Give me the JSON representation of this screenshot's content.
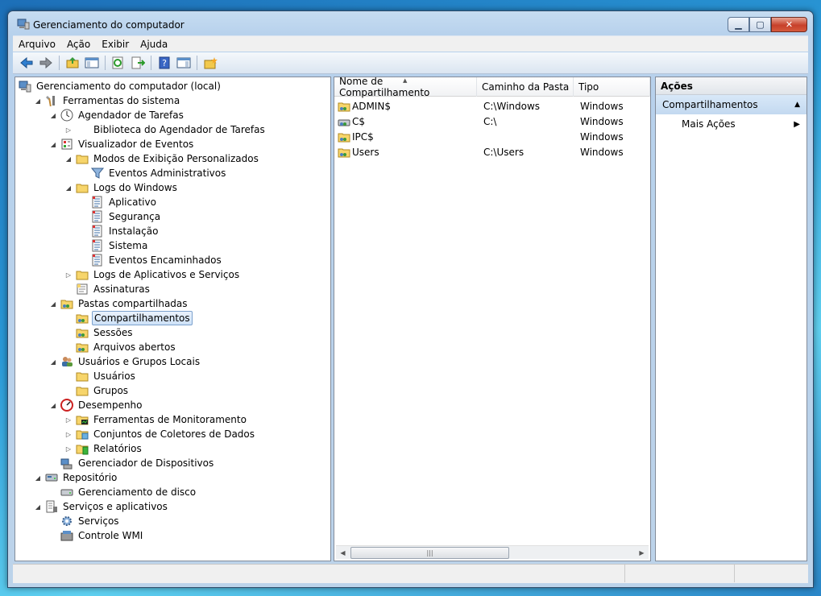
{
  "window": {
    "title": "Gerenciamento do computador",
    "controls": {
      "minimize": "▁",
      "maximize": "▢",
      "close": "✕"
    }
  },
  "menu": [
    "Arquivo",
    "Ação",
    "Exibir",
    "Ajuda"
  ],
  "toolbar": [
    "back-icon",
    "forward-icon",
    "up-folder-icon",
    "show-hide-tree-icon",
    "refresh-icon",
    "export-list-icon",
    "help-icon",
    "show-hide-action-pane-icon",
    "new-share-icon"
  ],
  "tree": [
    {
      "label": "Gerenciamento do computador (local)",
      "level": 0,
      "expander": "",
      "icon": "computer-management-icon"
    },
    {
      "label": "Ferramentas do sistema",
      "level": 1,
      "expander": "open",
      "icon": "system-tools-icon"
    },
    {
      "label": "Agendador de Tarefas",
      "level": 2,
      "expander": "open",
      "icon": "clock-icon"
    },
    {
      "label": "Biblioteca do Agendador de Tarefas",
      "level": 3,
      "expander": "closed",
      "icon": ""
    },
    {
      "label": "Visualizador de Eventos",
      "level": 2,
      "expander": "open",
      "icon": "event-viewer-icon"
    },
    {
      "label": "Modos de Exibição Personalizados",
      "level": 3,
      "expander": "open",
      "icon": "folder-icon"
    },
    {
      "label": "Eventos Administrativos",
      "level": 4,
      "expander": "",
      "icon": "filter-icon"
    },
    {
      "label": "Logs do Windows",
      "level": 3,
      "expander": "open",
      "icon": "folder-icon"
    },
    {
      "label": "Aplicativo",
      "level": 4,
      "expander": "",
      "icon": "log-icon"
    },
    {
      "label": "Segurança",
      "level": 4,
      "expander": "",
      "icon": "log-icon"
    },
    {
      "label": "Instalação",
      "level": 4,
      "expander": "",
      "icon": "log-icon"
    },
    {
      "label": "Sistema",
      "level": 4,
      "expander": "",
      "icon": "log-icon"
    },
    {
      "label": "Eventos Encaminhados",
      "level": 4,
      "expander": "",
      "icon": "log-icon"
    },
    {
      "label": "Logs de Aplicativos e Serviços",
      "level": 3,
      "expander": "closed",
      "icon": "folder-icon"
    },
    {
      "label": "Assinaturas",
      "level": 3,
      "expander": "",
      "icon": "subscriptions-icon"
    },
    {
      "label": "Pastas compartilhadas",
      "level": 2,
      "expander": "open",
      "icon": "shared-folder-icon"
    },
    {
      "label": "Compartilhamentos",
      "level": 3,
      "expander": "",
      "icon": "shared-folder-icon",
      "selected": true
    },
    {
      "label": "Sessões",
      "level": 3,
      "expander": "",
      "icon": "shared-folder-icon"
    },
    {
      "label": "Arquivos abertos",
      "level": 3,
      "expander": "",
      "icon": "shared-folder-icon"
    },
    {
      "label": "Usuários e Grupos Locais",
      "level": 2,
      "expander": "open",
      "icon": "users-icon"
    },
    {
      "label": "Usuários",
      "level": 3,
      "expander": "",
      "icon": "folder-icon"
    },
    {
      "label": "Grupos",
      "level": 3,
      "expander": "",
      "icon": "folder-icon"
    },
    {
      "label": "Desempenho",
      "level": 2,
      "expander": "open",
      "icon": "performance-icon"
    },
    {
      "label": "Ferramentas de Monitoramento",
      "level": 3,
      "expander": "closed",
      "icon": "monitor-folder-icon"
    },
    {
      "label": "Conjuntos de Coletores de Dados",
      "level": 3,
      "expander": "closed",
      "icon": "collector-folder-icon"
    },
    {
      "label": "Relatórios",
      "level": 3,
      "expander": "closed",
      "icon": "reports-folder-icon"
    },
    {
      "label": "Gerenciador de Dispositivos",
      "level": 2,
      "expander": "",
      "icon": "device-manager-icon"
    },
    {
      "label": "Repositório",
      "level": 1,
      "expander": "open",
      "icon": "storage-icon"
    },
    {
      "label": "Gerenciamento de disco",
      "level": 2,
      "expander": "",
      "icon": "disk-icon"
    },
    {
      "label": "Serviços e aplicativos",
      "level": 1,
      "expander": "open",
      "icon": "services-apps-icon"
    },
    {
      "label": "Serviços",
      "level": 2,
      "expander": "",
      "icon": "gear-icon"
    },
    {
      "label": "Controle WMI",
      "level": 2,
      "expander": "",
      "icon": "wmi-icon"
    }
  ],
  "list": {
    "columns": [
      "Nome de Compartilhamento",
      "Caminho da Pasta",
      "Tipo"
    ],
    "rows": [
      {
        "name": "ADMIN$",
        "path": "C:\\Windows",
        "type": "Windows",
        "icon": "share-icon"
      },
      {
        "name": "C$",
        "path": "C:\\",
        "type": "Windows",
        "icon": "drive-share-icon"
      },
      {
        "name": "IPC$",
        "path": "",
        "type": "Windows",
        "icon": "share-icon"
      },
      {
        "name": "Users",
        "path": "C:\\Users",
        "type": "Windows",
        "icon": "share-icon"
      }
    ]
  },
  "actions": {
    "title": "Ações",
    "section": "Compartilhamentos",
    "item": "Mais Ações"
  }
}
